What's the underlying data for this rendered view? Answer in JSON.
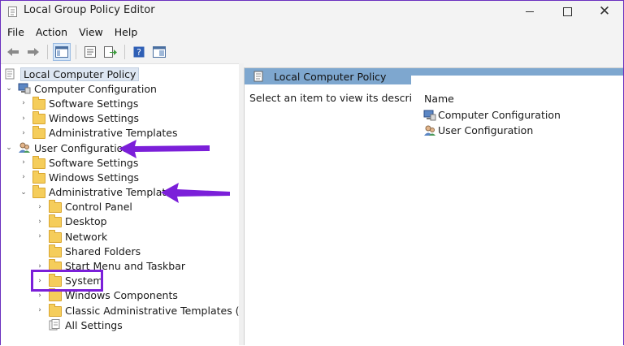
{
  "window": {
    "title": "Local Group Policy Editor"
  },
  "menu": [
    "File",
    "Action",
    "View",
    "Help"
  ],
  "toolbar": [
    "back-icon",
    "forward-icon",
    "show-hide-tree-icon",
    "properties-icon",
    "export-list-icon",
    "help-icon",
    "extended-view-icon"
  ],
  "tree": {
    "root": "Local Computer Policy",
    "computer_config": "Computer Configuration",
    "computer_children": [
      "Software Settings",
      "Windows Settings",
      "Administrative Templates"
    ],
    "user_config": "User Configuration",
    "user_children": [
      "Software Settings",
      "Windows Settings"
    ],
    "admin_templates": "Administrative Templates",
    "admin_children": [
      "Control Panel",
      "Desktop",
      "Network",
      "Shared Folders",
      "Start Menu and Taskbar",
      "System",
      "Windows Components",
      "Classic Administrative Templates (ADM)"
    ],
    "all_settings": "All Settings"
  },
  "right_pane": {
    "header": "Local Computer Policy",
    "description": "Select an item to view its description.",
    "column": "Name",
    "items": [
      "Computer Configuration",
      "User Configuration"
    ]
  },
  "colors": {
    "annotation": "#7b1fd9",
    "header_bar": "#7ea7cf",
    "folder": "#f5cd5b"
  }
}
